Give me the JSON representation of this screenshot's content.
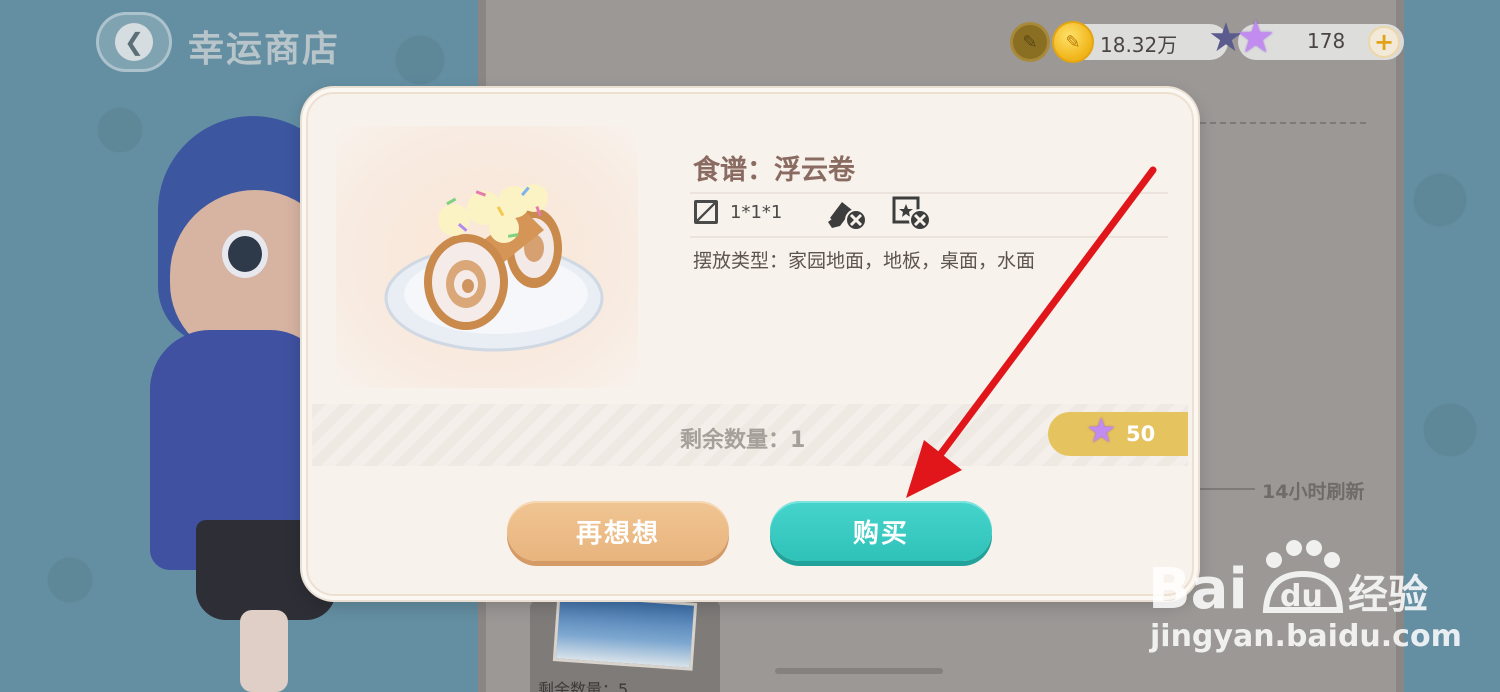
{
  "header": {
    "title": "幸运商店"
  },
  "currency": {
    "coins": "18.32万",
    "stars": "178",
    "add_label": "+"
  },
  "item": {
    "name": "食谱：浮云卷",
    "size": "1*1*1",
    "placement": "摆放类型：家园地面，地板，桌面，水面",
    "remaining": "剩余数量：1",
    "price": "50"
  },
  "buttons": {
    "cancel": "再想想",
    "buy": "购买"
  },
  "shop": {
    "refresh_note": "14小时刷新",
    "card_remaining": "剩余数量：5"
  },
  "watermark": {
    "brand": "Baidu经验",
    "url": "jingyan.baidu.com"
  },
  "colors": {
    "buy_button": "#2fc2b8",
    "cancel_button": "#e8b47e",
    "price_tag": "#e5c35e",
    "annotation_arrow": "#e0161b"
  }
}
